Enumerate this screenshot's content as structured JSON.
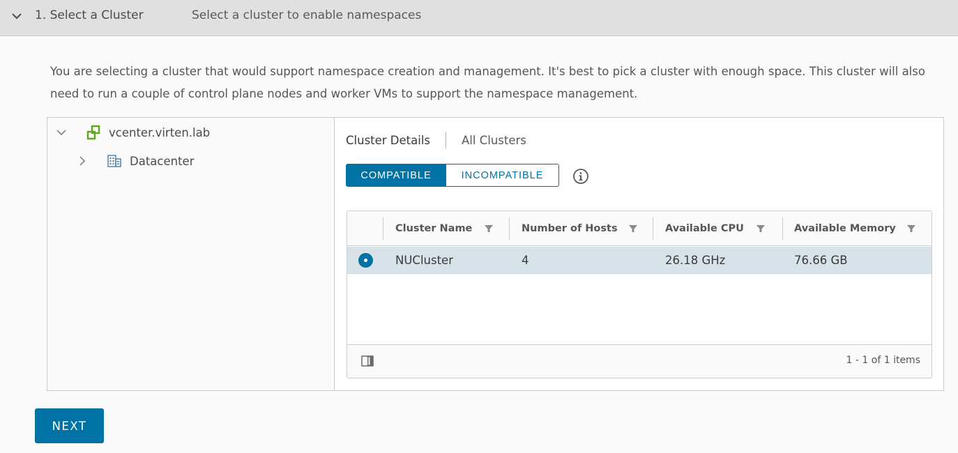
{
  "step": {
    "title": "1. Select a Cluster",
    "description": "Select a cluster to enable namespaces"
  },
  "intro_text": "You are selecting a cluster that would support namespace creation and management. It's best to pick a cluster with enough space. This cluster will also need to run a couple of control plane nodes and worker VMs to support the namespace management.",
  "tree": {
    "root": {
      "label": "vcenter.virten.lab",
      "icon": "vcenter-icon",
      "expanded": true
    },
    "children": [
      {
        "label": "Datacenter",
        "icon": "datacenter-icon",
        "expanded": false
      }
    ]
  },
  "details": {
    "tabs": [
      {
        "label": "Cluster Details",
        "active": true
      },
      {
        "label": "All Clusters",
        "active": false
      }
    ],
    "toggle": [
      {
        "label": "COMPATIBLE",
        "active": true
      },
      {
        "label": "INCOMPATIBLE",
        "active": false
      }
    ]
  },
  "grid": {
    "columns": [
      "Cluster Name",
      "Number of Hosts",
      "Available CPU",
      "Available Memory"
    ],
    "rows": [
      {
        "selected": true,
        "cells": [
          "NUCluster",
          "4",
          "26.18 GHz",
          "76.66 GB"
        ]
      }
    ],
    "pagination": "1 - 1 of 1 items"
  },
  "actions": {
    "next_label": "NEXT"
  },
  "colors": {
    "accent": "#0072a3",
    "selected_row": "#d8e3e9",
    "header_bg": "#e0e0e0",
    "vcenter_icon": "#62a420"
  }
}
